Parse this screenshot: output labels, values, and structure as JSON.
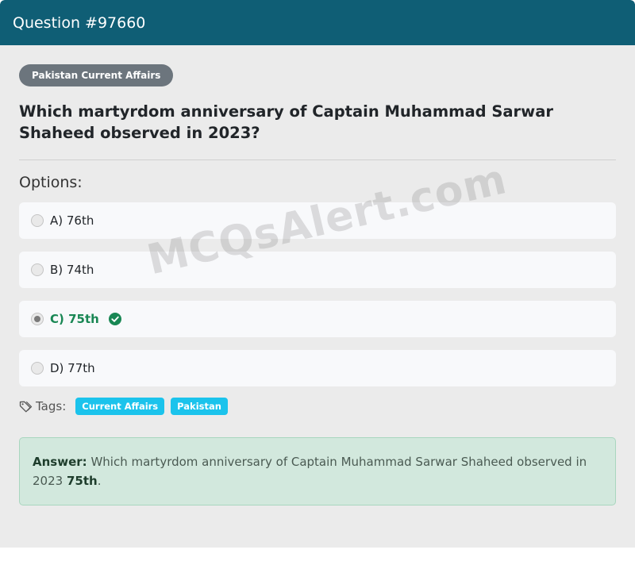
{
  "header": {
    "title": "Question #97660"
  },
  "category": "Pakistan Current Affairs",
  "question": "Which martyrdom anniversary of Captain Muhammad Sarwar Shaheed observed in 2023?",
  "options_heading": "Options:",
  "options": [
    {
      "label": "A) 76th",
      "selected": false,
      "correct": false
    },
    {
      "label": "B) 74th",
      "selected": false,
      "correct": false
    },
    {
      "label": "C) 75th",
      "selected": true,
      "correct": true
    },
    {
      "label": "D) 77th",
      "selected": false,
      "correct": false
    }
  ],
  "tags": {
    "label": "Tags:",
    "items": [
      "Current Affairs",
      "Pakistan"
    ]
  },
  "answer": {
    "label": "Answer:",
    "text": "Which martyrdom anniversary of Captain Muhammad Sarwar Shaheed observed in 2023",
    "value": "75th",
    "suffix": "."
  },
  "watermark": "MCQsAlert.com",
  "colors": {
    "header": "#0f5e75",
    "badge": "#6c757d",
    "tag": "#1bc3ec",
    "correct": "#198754",
    "answer_bg": "#d2e8dd"
  },
  "icons": [
    "check-circle-icon",
    "tag-icon",
    "radio-icon"
  ]
}
